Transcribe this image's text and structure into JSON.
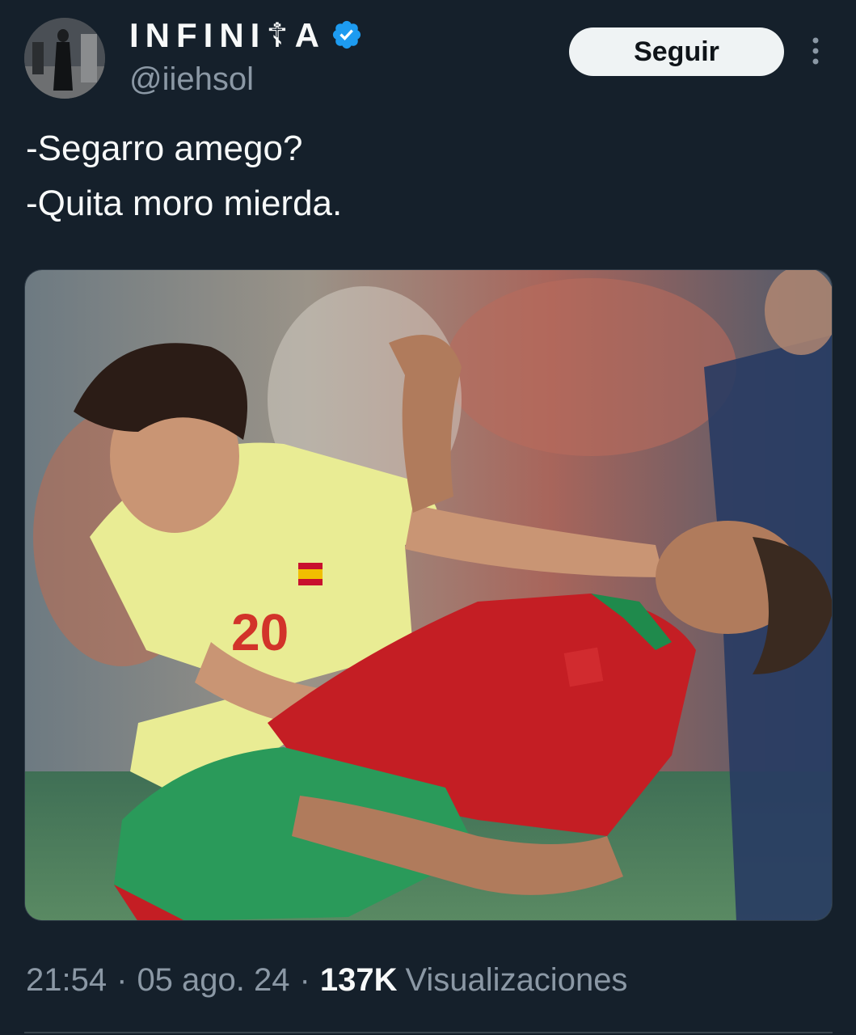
{
  "author": {
    "display_name": "INFINI☦A",
    "handle": "@iiehsol",
    "verified": true,
    "avatar_icon": "user-avatar"
  },
  "follow_button": {
    "label": "Seguir"
  },
  "more_icon": "more-vertical-icon",
  "tweet": {
    "lines": [
      "-Segarro amego?",
      "-Quita moro mierda."
    ]
  },
  "media": {
    "jersey_number": "20"
  },
  "meta": {
    "time": "21:54",
    "date": "05 ago. 24",
    "views_count": "137K",
    "views_label": "Visualizaciones",
    "separator": "·"
  },
  "colors": {
    "background": "#15202b",
    "text": "#f7f9f9",
    "muted": "#8b98a5",
    "verified": "#1d9bf0",
    "follow_bg": "#eff3f4"
  }
}
